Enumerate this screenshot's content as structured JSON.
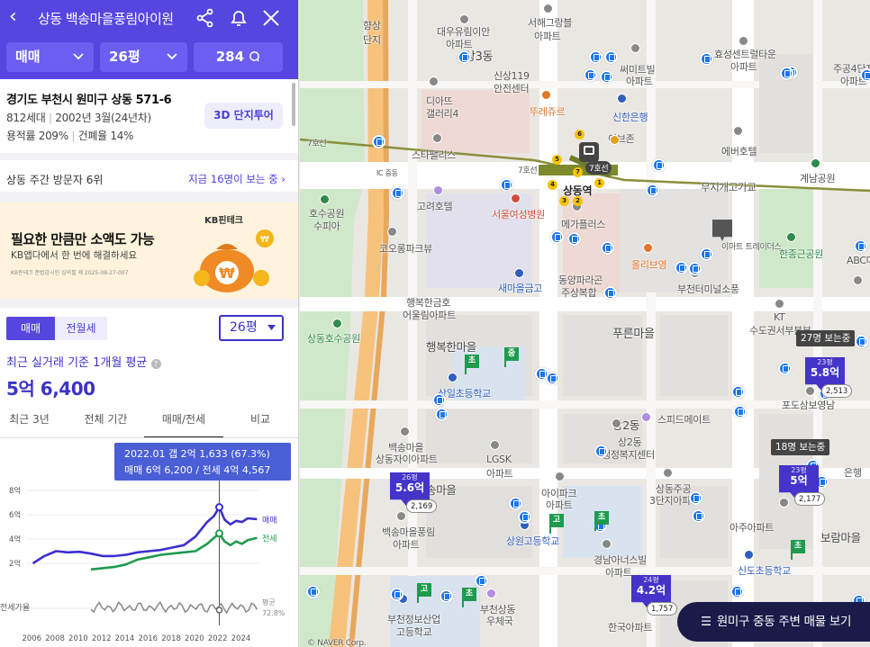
{
  "header": {
    "title": "상동 백송마을풍림아이원",
    "deal_type": "매매",
    "size": "26평",
    "comments": "284"
  },
  "info": {
    "address": "경기도 부천시 원미구 상동 571-6",
    "households": "812세대",
    "built": "2002년 3월(24년차)",
    "far": "용적률 209%",
    "bcr": "건폐율 14%",
    "tour_button": "3D 단지투어"
  },
  "rank": {
    "label": "상동 주간 방문자 6위",
    "link": "지금 16명이 보는 중 ›"
  },
  "ad": {
    "brand": "KB핀테크",
    "title": "필요한 만큼만 소액도 가능",
    "subtitle": "KB앱다에서 한 번에 해결하세요",
    "fine": "KB핀테크 준법감시인 심의필 제 2025-08-27-007"
  },
  "price": {
    "tab_sale": "매매",
    "tab_rent": "전월세",
    "size_select": "26평",
    "avg_label": "최근 실거래 기준 1개월 평균",
    "avg_value": "5억 6,400"
  },
  "period_tabs": [
    "최근 3년",
    "전체 기간",
    "매매/전세",
    "비교"
  ],
  "chart_data": {
    "type": "line",
    "tooltip": {
      "line1": "2022.01  갭 2억 1,633 (67.3%)",
      "line2": "매매 6억 6,200 / 전세 4억 4,567"
    },
    "y_ticks": [
      "8억",
      "6억",
      "4억",
      "2억"
    ],
    "ylim": [
      0,
      8
    ],
    "x_ticks": [
      "2006",
      "2008",
      "2010",
      "2012",
      "2014",
      "2016",
      "2018",
      "2020",
      "2022",
      "2024"
    ],
    "series": [
      {
        "name": "매매",
        "color": "#3d2fd0",
        "x": [
          2006,
          2007,
          2008,
          2009,
          2010,
          2011,
          2012,
          2013,
          2014,
          2015,
          2016,
          2017,
          2018,
          2019,
          2020,
          2021,
          2021.6,
          2022.05,
          2022.5,
          2023,
          2023.5,
          2024,
          2024.5,
          2025.3
        ],
        "values": [
          2.0,
          2.6,
          3.0,
          2.9,
          2.95,
          2.8,
          2.6,
          2.6,
          2.7,
          2.9,
          3.0,
          3.1,
          3.3,
          3.5,
          4.2,
          5.4,
          5.9,
          6.62,
          5.6,
          5.2,
          5.5,
          5.4,
          5.7,
          5.64
        ]
      },
      {
        "name": "전세",
        "color": "#1e9b4e",
        "x": [
          2011,
          2012,
          2013,
          2014,
          2015,
          2016,
          2017,
          2018,
          2019,
          2020,
          2021,
          2021.6,
          2022.05,
          2022.5,
          2023,
          2023.5,
          2024,
          2024.5,
          2025.3
        ],
        "values": [
          1.5,
          1.6,
          1.7,
          1.9,
          2.3,
          2.5,
          2.7,
          2.8,
          2.9,
          3.0,
          3.6,
          4.1,
          4.46,
          3.8,
          3.5,
          3.8,
          3.6,
          3.9,
          4.1
        ]
      }
    ],
    "gap_label": "전세가율",
    "gap_sub": "평균",
    "gap_avg": "72.8%",
    "legend_sale": "매매",
    "legend_rent": "전세"
  },
  "map": {
    "labels": {
      "l1": "서해그랑블",
      "l1b": "아파트",
      "l2": "대우유림이안",
      "l2b": "아파트",
      "l3": "상3동",
      "l4": "효성센트럴타운",
      "l4b": "아파트",
      "l5": "주공4단지",
      "l5b": "아파트",
      "l6": "써미트빌",
      "l6b": "아파트",
      "l7": "신상119",
      "l7b": "안전센터",
      "l8": "디아뜨",
      "l8b": "갤러리4",
      "l9": "뚜레쥬르",
      "l10": "신한은행",
      "l11": "이브존",
      "l12": "에버호텔",
      "l13": "스타팰리스",
      "l14": "7호선",
      "l15": "상동역",
      "l16": "무지개고가교",
      "l17": "계남공원",
      "l18": "고려호텔",
      "l19": "서울여성병원",
      "l20": "메가플러스",
      "l21": "상동호수공원",
      "l22": "코오롱파크뷰",
      "l23": "올리브영",
      "l24": "이마트 트레이더스",
      "l25": "한종근공원",
      "l26": "ABC마트",
      "l27": "행복한금호",
      "l27b": "어울림아파트",
      "l28": "동양파라곤",
      "l28b": "주상복합",
      "l29": "새마을금고",
      "l30": "부천터미널소풍",
      "l31": "KT",
      "l31b": "수도권서부본부",
      "l32": "푸른마을",
      "l33": "행복한마을",
      "l34": "상일초등학교",
      "l35": "상2동",
      "l36": "스피드메이트",
      "l37": "상2동",
      "l37b": "행정복지센터",
      "l38": "포도삼보영남",
      "l39": "LGSK",
      "l39b": "아파트",
      "l40": "백송마을",
      "l40b": "상동자이아파트",
      "l41": "송마을",
      "l42": "아이파크",
      "l42b": "아파트",
      "l43": "상동주공",
      "l43b": "3단지아파트",
      "l44": "백송마을풍림",
      "l44b": "아파트",
      "l45": "상원고등학교",
      "l46": "경남아너스빌",
      "l46b": "아파트",
      "l47": "아주아파트",
      "l48": "보람마을",
      "l49": "신도초등학교",
      "l50": "부천정보산업",
      "l50b": "고등학교",
      "l51": "부천상동",
      "l51b": "우체국",
      "l52": "한국아파트",
      "l53": "은행",
      "l54": "IC 중동",
      "l55": "7호선",
      "l56": "7호선",
      "l57": "향상",
      "l57b": "단지",
      "l58": "호수공원",
      "l58b": "수피아"
    },
    "markers": [
      {
        "size": "26평",
        "price": "5.6억",
        "count": "2,169"
      },
      {
        "size": "23평",
        "price": "5.8억",
        "count": "2,513",
        "tip": "27명 보는중"
      },
      {
        "size": "23평",
        "price": "5억",
        "count": "2,177",
        "tip": "18명 보는중"
      },
      {
        "size": "24평",
        "price": "4.2억",
        "count": "1,757"
      }
    ],
    "flags": [
      "초",
      "중",
      "고",
      "초",
      "고",
      "초",
      "초"
    ],
    "bottom_button": "원미구 중동 주변 매물 보기",
    "credit": "© NAVER Corp."
  },
  "url_hint": "...wt/5_@_0_f/S/0/jhit..."
}
